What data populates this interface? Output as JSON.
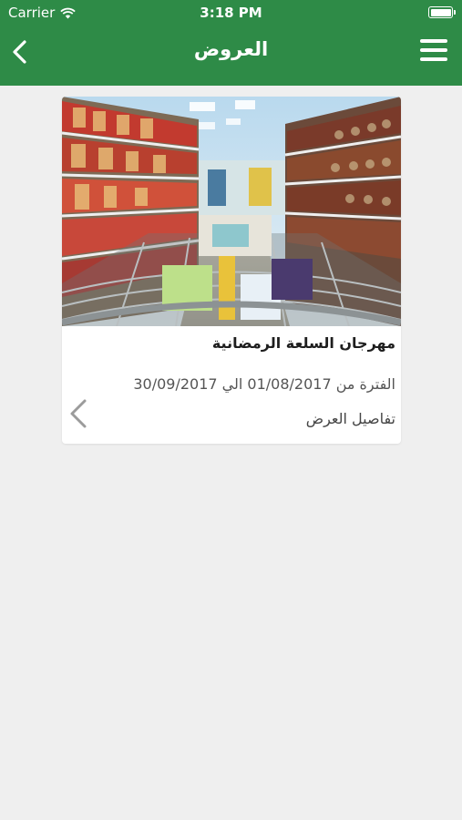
{
  "status_bar": {
    "carrier": "Carrier",
    "time": "3:18 PM",
    "icons": [
      "wifi-icon",
      "battery-icon"
    ]
  },
  "nav_bar": {
    "title": "العروض",
    "back_icon": "chevron-left-icon",
    "menu_icon": "hamburger-menu-icon"
  },
  "offers": [
    {
      "title": "مهرجان السلعة الرمضانية",
      "period": "الفترة من 01/08/2017 الي 30/09/2017",
      "details_label": "تفاصيل العرض",
      "image_icon": "supermarket-aisle-image"
    }
  ],
  "colors": {
    "accent": "#2e8b47",
    "background": "#efefef",
    "card": "#ffffff"
  }
}
